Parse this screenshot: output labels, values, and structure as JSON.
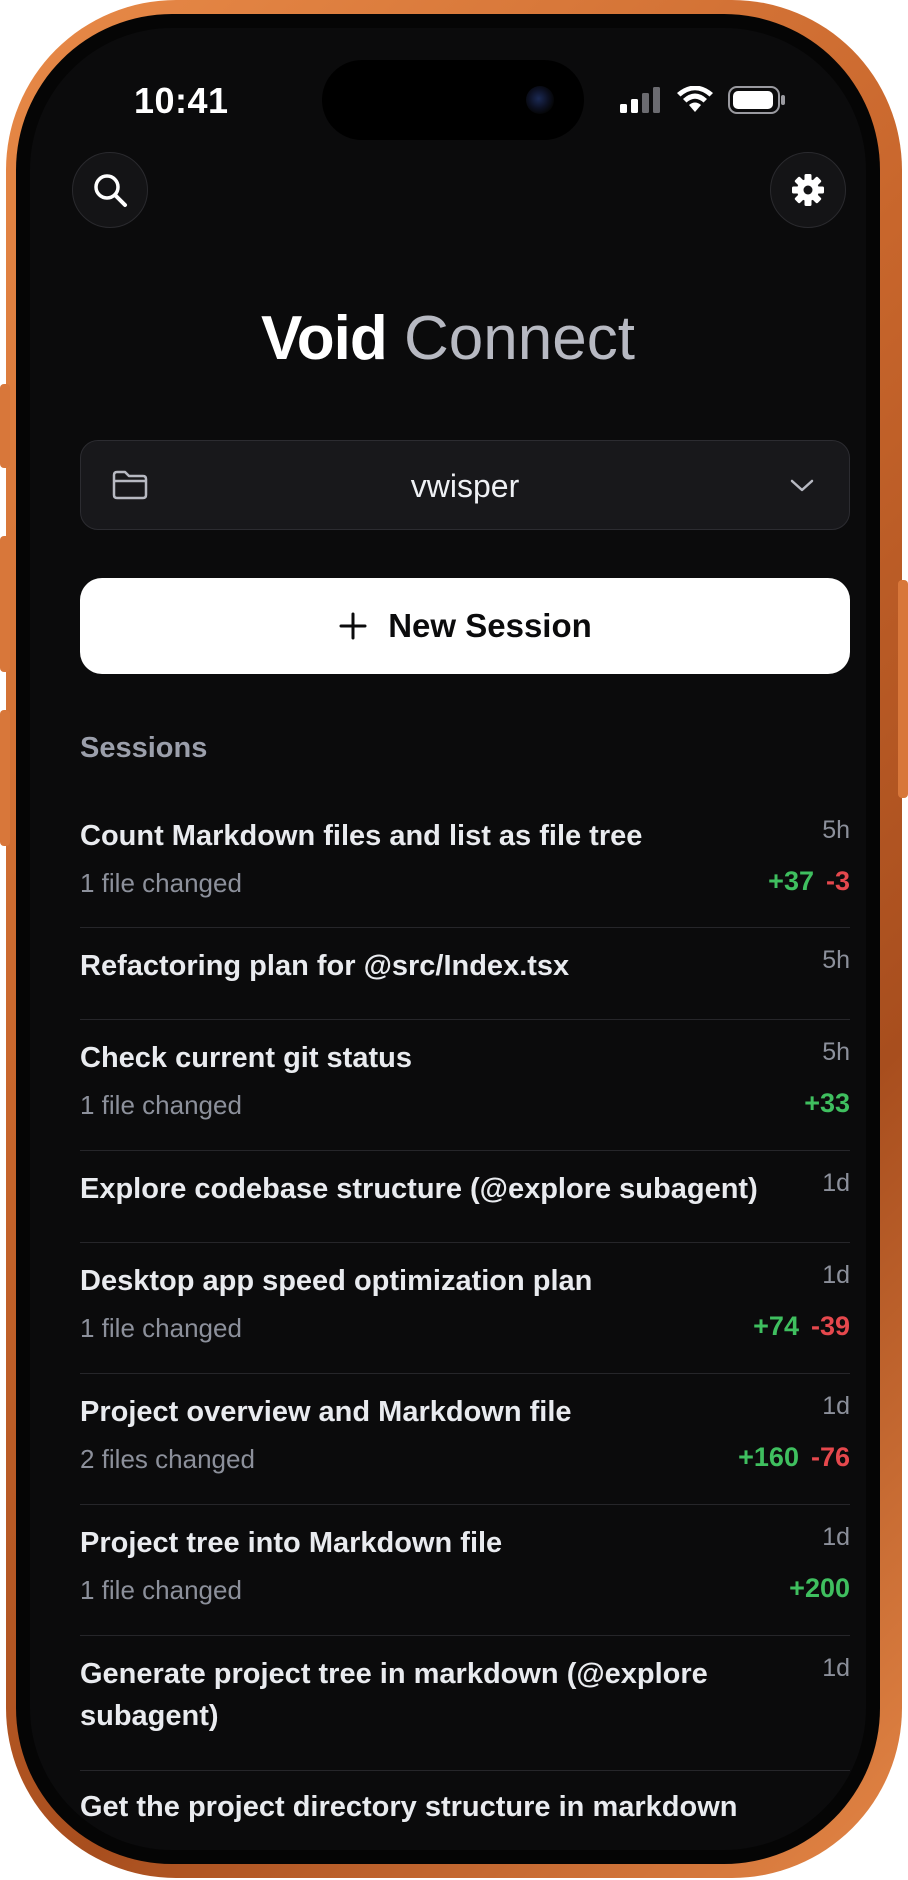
{
  "status_bar": {
    "time": "10:41"
  },
  "app": {
    "title_strong": "Void",
    "title_light": "Connect"
  },
  "project_select": {
    "value": "vwisper",
    "icon": "folder-icon",
    "chevron": "chevron-down-icon"
  },
  "new_session": {
    "label": "New Session",
    "icon": "plus-icon"
  },
  "sessions": {
    "heading": "Sessions",
    "items": [
      {
        "title": "Count Markdown files and list as file tree",
        "subtitle": "1 file changed",
        "age": "5h",
        "added": "+37",
        "removed": "-3"
      },
      {
        "title": "Refactoring plan for @src/Index.tsx",
        "subtitle": "",
        "age": "5h",
        "added": "",
        "removed": ""
      },
      {
        "title": "Check current git status",
        "subtitle": "1 file changed",
        "age": "5h",
        "added": "+33",
        "removed": ""
      },
      {
        "title": "Explore codebase structure (@explore subagent)",
        "subtitle": "",
        "age": "1d",
        "added": "",
        "removed": ""
      },
      {
        "title": "Desktop app speed optimization plan",
        "subtitle": "1 file changed",
        "age": "1d",
        "added": "+74",
        "removed": "-39"
      },
      {
        "title": "Project overview and Markdown file",
        "subtitle": "2 files changed",
        "age": "1d",
        "added": "+160",
        "removed": "-76"
      },
      {
        "title": "Project tree into Markdown file",
        "subtitle": "1 file changed",
        "age": "1d",
        "added": "+200",
        "removed": ""
      },
      {
        "title_line1": "Generate project tree in markdown (@explore",
        "title_line2": "subagent)",
        "subtitle": "",
        "age": "1d",
        "added": "",
        "removed": ""
      },
      {
        "title": "Get the project directory structure in markdown",
        "subtitle": "",
        "age": "",
        "added": "",
        "removed": ""
      }
    ]
  },
  "colors": {
    "added": "#3fbf5f",
    "removed": "#e5484d",
    "background": "#0b0b0c",
    "frame": "#c8662c"
  }
}
